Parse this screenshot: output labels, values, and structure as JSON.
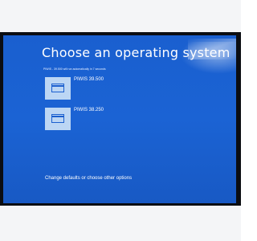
{
  "boot_menu": {
    "title": "Choose an operating system",
    "subtitle": "PIWIS - 39.500 will run automatically in 7 seconds",
    "entries": [
      {
        "label": "PIWIS  39.500",
        "icon": "windows-tile-icon"
      },
      {
        "label": "PIWIS  38.250",
        "icon": "windows-tile-icon"
      }
    ],
    "footer_link": "Change defaults or choose other options"
  },
  "colors": {
    "background": "#1b63d4",
    "tile": "#bcd6f4",
    "text": "#ffffff"
  }
}
